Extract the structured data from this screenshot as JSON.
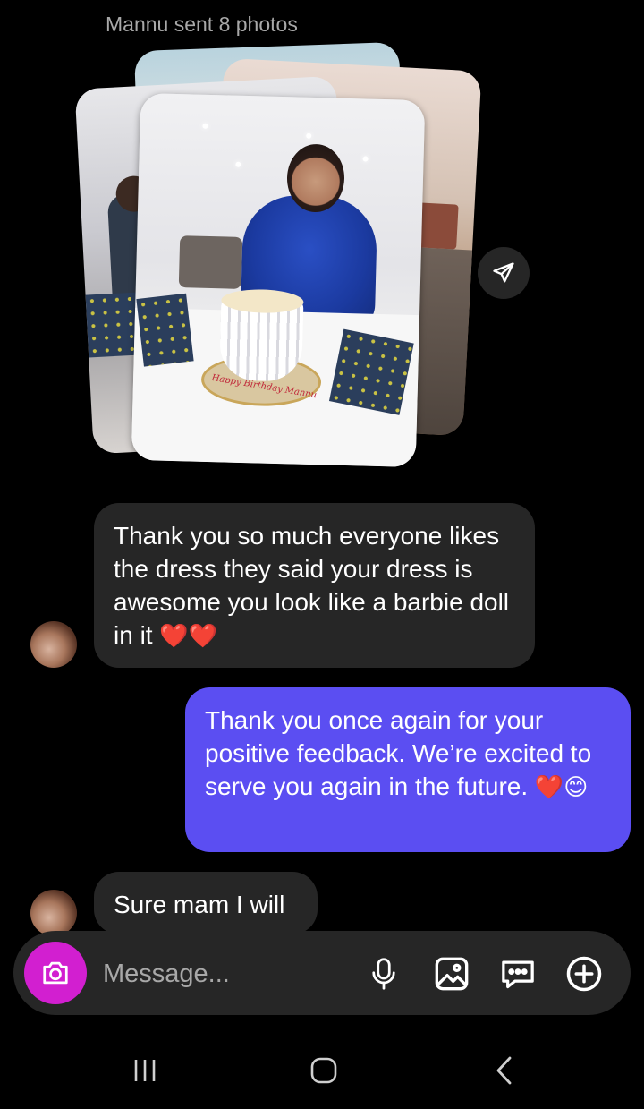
{
  "thread": {
    "photo_header": "Mannu sent 8 photos",
    "messages": [
      {
        "from": "them",
        "text": "Thank you so much everyone likes the dress they said your dress is awesome you look like a barbie doll in it",
        "emoji": "❤️❤️"
      },
      {
        "from": "me",
        "text": "Thank you once again for your positive feedback. We’re excited to serve you again in the future.",
        "emoji": "❤️😊"
      },
      {
        "from": "them",
        "text": "Sure mam I will"
      }
    ]
  },
  "photo": {
    "cake_text": "Happy Birthday Mannu"
  },
  "composer": {
    "placeholder": "Message..."
  },
  "icons": {
    "share": "send-icon",
    "camera": "camera-icon",
    "mic": "microphone-icon",
    "gallery": "gallery-icon",
    "sticker": "sticker-chat-icon",
    "plus": "plus-icon",
    "nav_recents": "recents-icon",
    "nav_home": "home-icon",
    "nav_back": "back-icon"
  },
  "colors": {
    "background": "#000000",
    "incoming_bubble": "#262626",
    "outgoing_bubble": "#5b4ef2",
    "camera_button": "#d21fd0"
  }
}
